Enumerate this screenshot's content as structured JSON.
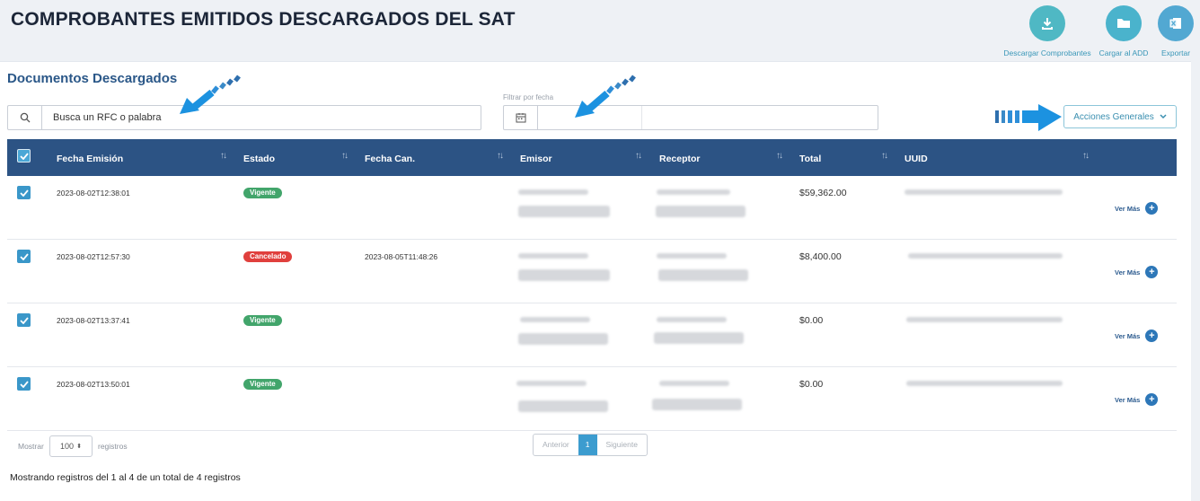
{
  "page": {
    "title": "COMPROBANTES EMITIDOS DESCARGADOS DEL SAT"
  },
  "header_actions": [
    {
      "label": "Descargar Comprobantes",
      "icon": "download-icon",
      "color": "#4fb8c4"
    },
    {
      "label": "Cargar al ADD",
      "icon": "folder-icon",
      "color": "#4ab3cc"
    },
    {
      "label": "Exportar",
      "icon": "excel-icon",
      "color": "#52a8d2"
    }
  ],
  "section": {
    "title": "Documentos Descargados"
  },
  "search": {
    "text": "Busca un RFC o palabra"
  },
  "date_filter": {
    "label": "Filtrar por fecha"
  },
  "acciones": {
    "label": "Acciones Generales"
  },
  "table": {
    "columns": [
      "Fecha Emisión",
      "Estado",
      "Fecha Can.",
      "Emisor",
      "Receptor",
      "Total",
      "UUID"
    ],
    "rows": [
      {
        "fecha": "2023-08-02T12:38:01",
        "estado": "Vigente",
        "estado_color": "#42a56b",
        "fecha_can": "",
        "total": "$59,362.00",
        "ver_mas": "Ver Más"
      },
      {
        "fecha": "2023-08-02T12:57:30",
        "estado": "Cancelado",
        "estado_color": "#e0403d",
        "fecha_can": "2023-08-05T11:48:26",
        "total": "$8,400.00",
        "ver_mas": "Ver Más"
      },
      {
        "fecha": "2023-08-02T13:37:41",
        "estado": "Vigente",
        "estado_color": "#42a56b",
        "fecha_can": "",
        "total": "$0.00",
        "ver_mas": "Ver Más"
      },
      {
        "fecha": "2023-08-02T13:50:01",
        "estado": "Vigente",
        "estado_color": "#42a56b",
        "fecha_can": "",
        "total": "$0.00",
        "ver_mas": "Ver Más"
      }
    ]
  },
  "footer": {
    "mostrar": "Mostrar",
    "page_size": "100",
    "registros": "registros",
    "pager": {
      "prev": "Anterior",
      "current": "1",
      "next": "Siguiente"
    },
    "summary": "Mostrando registros del 1 al 4 de un total de 4 registros"
  }
}
